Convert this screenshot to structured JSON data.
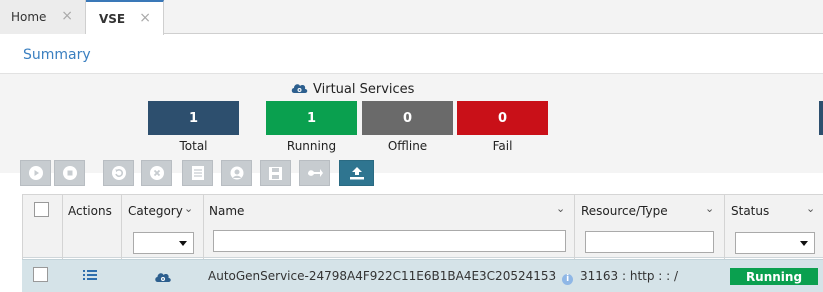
{
  "tabs": [
    {
      "label": "Home",
      "close": "×"
    },
    {
      "label": "VSE",
      "close": "×"
    }
  ],
  "summary": {
    "title": "Summary",
    "group_title": "Virtual Services",
    "tiles": [
      {
        "value": "1",
        "label": "Total",
        "color": "#2d4f6e"
      },
      {
        "value": "1",
        "label": "Running",
        "color": "#0aa04f"
      },
      {
        "value": "0",
        "label": "Offline",
        "color": "#6a6a6a"
      },
      {
        "value": "0",
        "label": "Fail",
        "color": "#c91018"
      }
    ]
  },
  "toolbar": {
    "icons": [
      "play-icon",
      "stop-icon",
      "restart-icon",
      "delete-icon",
      "log-icon",
      "agent-icon",
      "save-icon",
      "deploy-icon",
      "upload-icon"
    ]
  },
  "table": {
    "columns": {
      "actions": "Actions",
      "category": "Category",
      "name": "Name",
      "resource": "Resource/Type",
      "status": "Status"
    },
    "filters": {
      "category": "",
      "name": "",
      "resource": "",
      "status": ""
    },
    "rows": [
      {
        "name": "AutoGenService-24798A4F922C11E6B1BA4E3C20524153",
        "resource": "31163 : http : : /",
        "status": "Running",
        "info": "i"
      }
    ]
  },
  "colors": {
    "accent": "#3a7fc0",
    "running": "#0aa04f",
    "fail": "#c91018",
    "offline": "#6a6a6a",
    "total": "#2d4f6e"
  }
}
